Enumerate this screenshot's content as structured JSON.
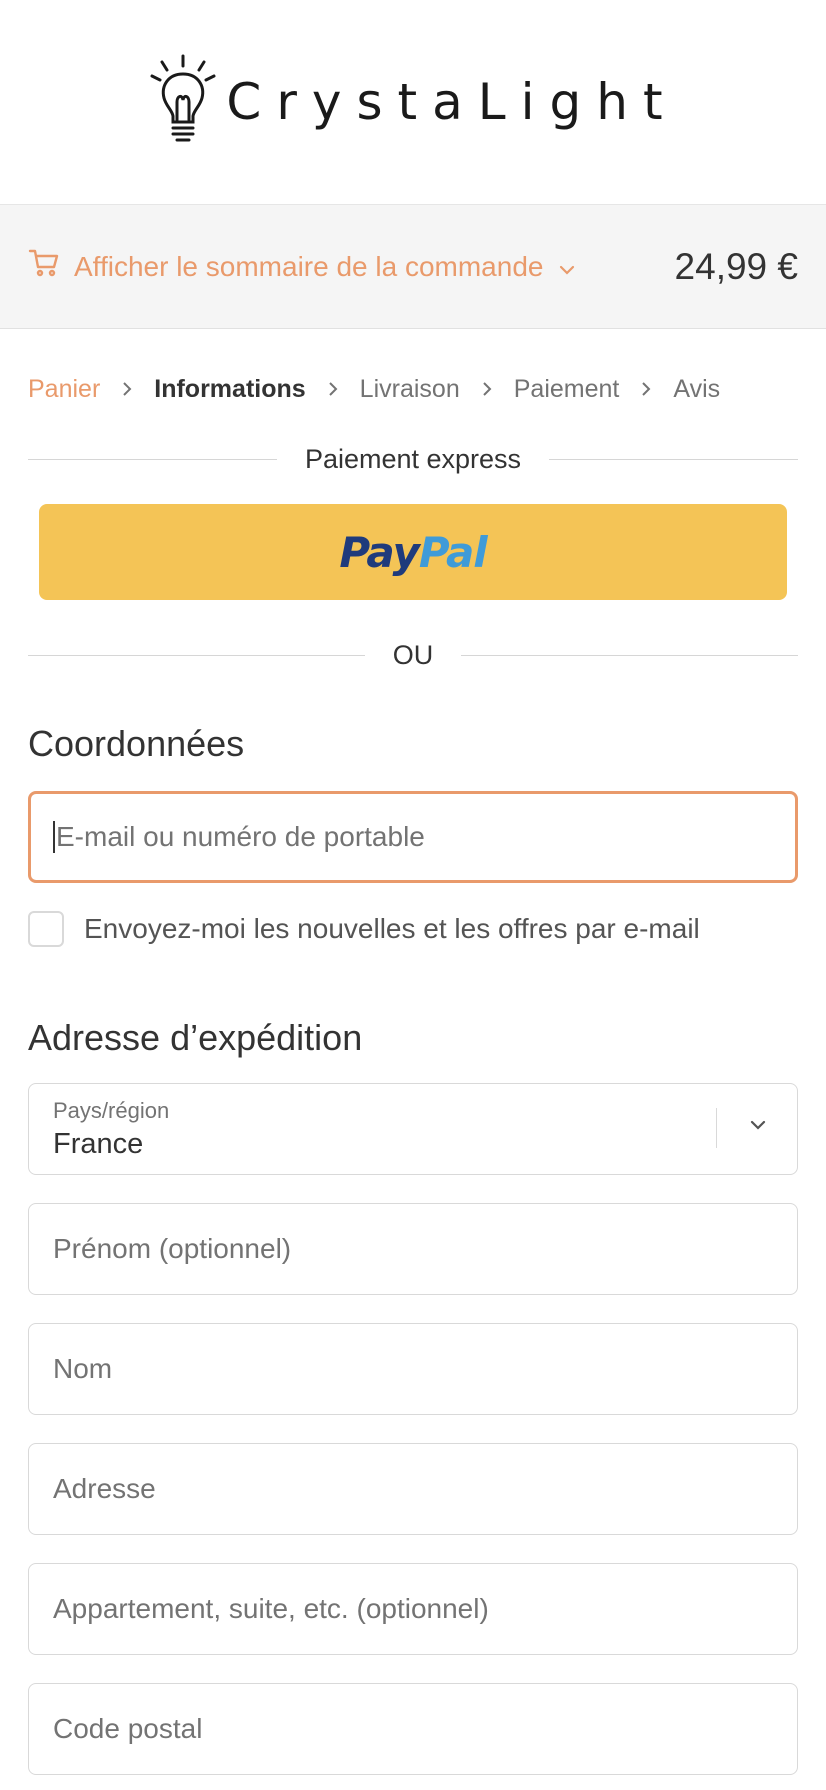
{
  "brand": {
    "name": "CrystaLight",
    "logo_icon": "lightbulb-icon"
  },
  "summary": {
    "toggle_label": "Afficher le sommaire de la commande",
    "total": "24,99 €",
    "icon": "cart-icon"
  },
  "breadcrumb": {
    "items": [
      {
        "label": "Panier"
      },
      {
        "label": "Informations"
      },
      {
        "label": "Livraison"
      },
      {
        "label": "Paiement"
      },
      {
        "label": "Avis"
      }
    ]
  },
  "express": {
    "title": "Paiement express",
    "paypal_part1": "Pay",
    "paypal_part2": "Pal"
  },
  "or_label": "OU",
  "contact": {
    "title": "Coordonnées",
    "email_placeholder": "E-mail ou numéro de portable",
    "newsletter_label": "Envoyez-moi les nouvelles et les offres par e-mail"
  },
  "shipping": {
    "title": "Adresse d’expédition",
    "country_label": "Pays/région",
    "country_value": "France",
    "first_name_placeholder": "Prénom (optionnel)",
    "last_name_placeholder": "Nom",
    "address_placeholder": "Adresse",
    "apartment_placeholder": "Appartement, suite, etc. (optionnel)",
    "postal_placeholder": "Code postal"
  },
  "colors": {
    "accent": "#e99a6b",
    "paypal_bg": "#f4c456",
    "paypal_dark": "#1f3b7c",
    "paypal_light": "#3f9bd8"
  }
}
